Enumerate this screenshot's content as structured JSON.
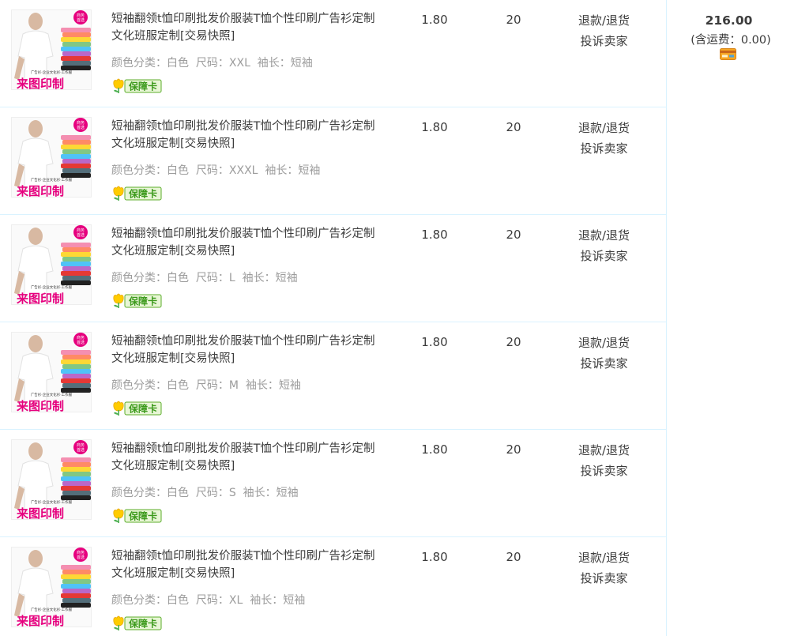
{
  "order": {
    "total_price": "216.00",
    "shipping_note": "(含运费：0.00)",
    "payment_icon": "credit-card-icon"
  },
  "item_defaults": {
    "title": "短袖翻领t恤印刷批发价服装T恤个性印刷广告衫定制文化班服定制[交易快照]",
    "price": "1.80",
    "quantity": "20",
    "refund_label": "退款/退货",
    "complain_label": "投诉卖家",
    "guarantee_label": "保障卡",
    "thumb_badge": "商务首选",
    "thumb_caption": "来图印制",
    "thumb_subcaption": "广告衫·企业文化衫·工作服"
  },
  "items": [
    {
      "sku": "颜色分类：白色  尺码：XXL  袖长：短袖"
    },
    {
      "sku": "颜色分类：白色  尺码：XXXL  袖长：短袖"
    },
    {
      "sku": "颜色分类：白色  尺码：L  袖长：短袖"
    },
    {
      "sku": "颜色分类：白色  尺码：M  袖长：短袖"
    },
    {
      "sku": "颜色分类：白色  尺码：S  袖长：短袖"
    },
    {
      "sku": "颜色分类：白色  尺码：XL  袖长：短袖"
    }
  ],
  "colors": {
    "border": "#daf3ff",
    "text": "#3c3c3c",
    "muted": "#9c9c9c",
    "accent_pink": "#e6007e",
    "guarantee_green": "#5cae2b",
    "guarantee_bg": "#e8f6d6"
  }
}
